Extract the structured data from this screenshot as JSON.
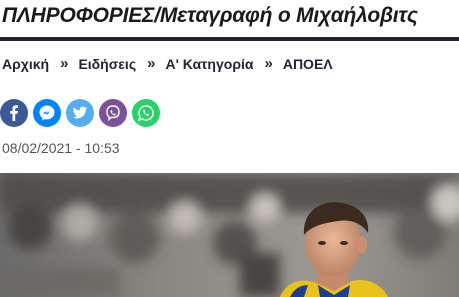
{
  "article": {
    "title": "ΠΛΗΡΟΦΟΡΙΕΣ/Μεταγραφή ο Μιχαήλοβιτς",
    "date": "08/02/2021 - 10:53"
  },
  "breadcrumb": {
    "items": [
      "Αρχική",
      "Ειδήσεις",
      "Α' Κατηγορία",
      "ΑΠΟΕΛ"
    ],
    "separator": "»"
  },
  "share": {
    "buttons": [
      {
        "icon": "facebook-icon",
        "color": "#3b5998"
      },
      {
        "icon": "messenger-icon",
        "color": "#0084ff"
      },
      {
        "icon": "twitter-icon",
        "color": "#55acee"
      },
      {
        "icon": "viber-icon",
        "color": "#7b519d"
      },
      {
        "icon": "whatsapp-icon",
        "color": "#25d366"
      }
    ]
  },
  "colors": {
    "title_rule": "#1f2430",
    "text": "#1a1a1a"
  }
}
